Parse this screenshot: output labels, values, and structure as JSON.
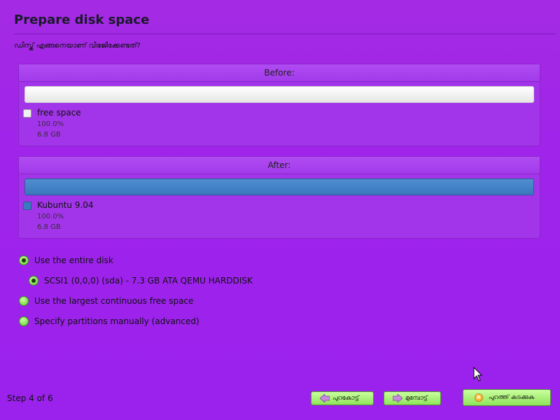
{
  "page": {
    "title": "Prepare disk space",
    "question": "ഡിസ്ക് എങ്ങനെയാണ് വിഭജിക്കേണ്ടത്?"
  },
  "before": {
    "header": "Before:",
    "legend_label": "free space",
    "percent": "100.0%",
    "size": "6.8 GB",
    "bar_color": "#f2f2f2"
  },
  "after": {
    "header": "After:",
    "legend_label": "Kubuntu 9.04",
    "percent": "100.0%",
    "size": "6.8 GB",
    "bar_color": "#3c7abf"
  },
  "options": [
    {
      "label": "Use the entire disk",
      "selected": true
    },
    {
      "label": "SCSI1 (0,0,0) (sda) - 7.3 GB ATA QEMU HARDDISK",
      "selected": true
    },
    {
      "label": "Use the largest continuous free space",
      "selected": false
    },
    {
      "label": "Specify partitions manually (advanced)",
      "selected": false
    }
  ],
  "footer": {
    "step": "Step 4 of 6",
    "back_label": "പുറകോട്ട്",
    "forward_label": "മുമ്പോട്ട്",
    "quit_label": "പുറത്ത് കടക്കുക"
  },
  "icons": {
    "back": "arrow-left-icon",
    "forward": "arrow-right-icon",
    "quit": "close-icon",
    "cursor": "mouse-pointer-icon"
  }
}
